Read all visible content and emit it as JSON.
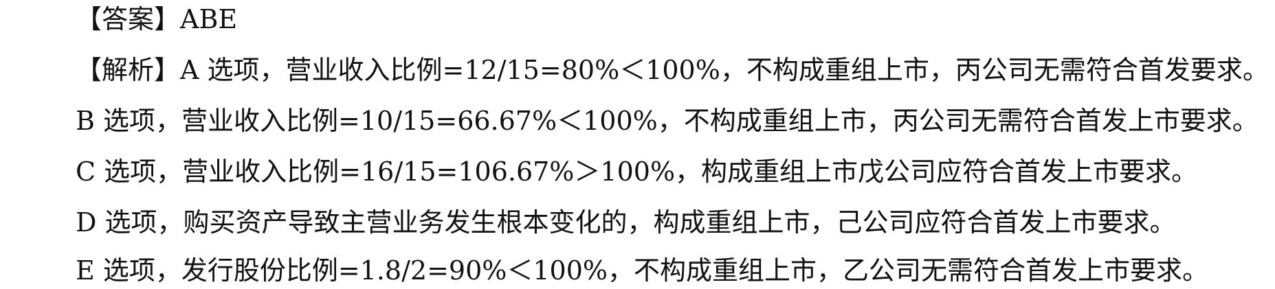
{
  "answer": {
    "label": "【答案】",
    "value": "ABE"
  },
  "analysis": {
    "label": "【解析】",
    "lines": [
      "A 选项，营业收入比例=12/15=80%＜100%，不构成重组上市，丙公司无需符合首发要求。",
      "B 选项，营业收入比例=10/15=66.67%＜100%，不构成重组上市，丙公司无需符合首发上市要求。",
      "C 选项，营业收入比例=16/15=106.67%＞100%，构成重组上市戊公司应符合首发上市要求。",
      "D 选项，购买资产导致主营业务发生根本变化的，构成重组上市，己公司应符合首发上市要求。",
      "E 选项，发行股份比例=1.8/2=90%＜100%，不构成重组上市，乙公司无需符合首发上市要求。"
    ]
  }
}
